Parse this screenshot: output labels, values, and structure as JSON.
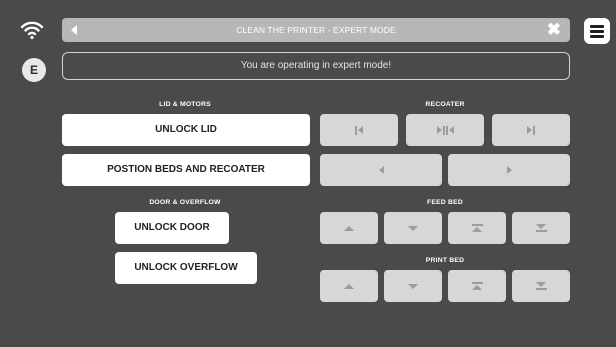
{
  "header": {
    "title": "CLEAN THE PRINTER - EXPERT MODE",
    "close_glyph": "✖"
  },
  "badge": {
    "label": "E"
  },
  "notice": {
    "text": "You are operating in expert mode!"
  },
  "sections": {
    "lid_motors": "LID & MOTORS",
    "recoater": "RECOATER",
    "door_overflow": "DOOR & OVERFLOW",
    "feed_bed": "FEED BED",
    "print_bed": "PRINT BED"
  },
  "buttons": {
    "unlock_lid": "UNLOCK LID",
    "position_beds": "POSTION BEDS AND RECOATER",
    "unlock_door": "UNLOCK DOOR",
    "unlock_overflow": "UNLOCK OVERFLOW"
  },
  "icons": {
    "back": "back-arrow-icon",
    "close": "close-icon",
    "menu": "hamburger-menu-icon",
    "wifi": "wifi-icon"
  },
  "colors": {
    "background": "#4a4a4a",
    "header_bar": "#b7b7b7",
    "disabled_button": "#d7d7d7",
    "enabled_button": "#ffffff",
    "icon_gray": "#9c9c9c"
  }
}
